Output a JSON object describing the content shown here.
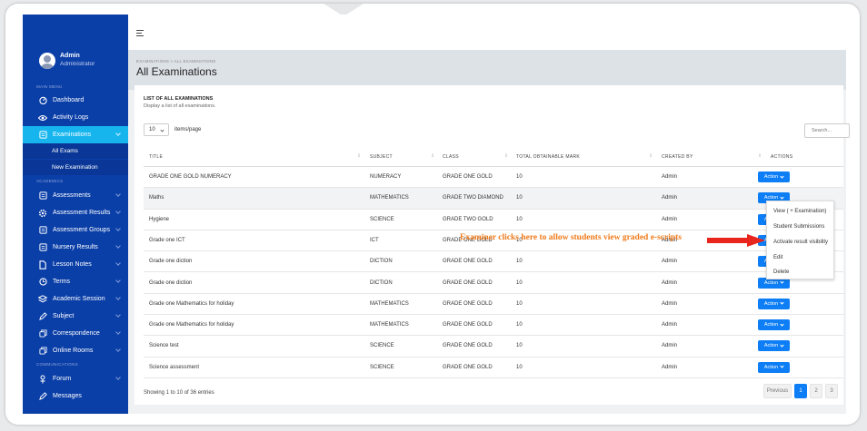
{
  "sidebar": {
    "user": {
      "name": "Admin",
      "role": "Administrator"
    },
    "sections": {
      "main": "MAIN MENU",
      "academic": "ACADEMICS",
      "communications": "COMMUNICATIONS"
    },
    "items": [
      {
        "label": "Dashboard",
        "icon": "dashboard-icon"
      },
      {
        "label": "Activity Logs",
        "icon": "eye-icon"
      },
      {
        "label": "Examinations",
        "icon": "document-icon",
        "active": true
      },
      {
        "label": "All Exams",
        "sub": true
      },
      {
        "label": "New Examination",
        "sub": true
      },
      {
        "label": "Assessments",
        "icon": "document-icon"
      },
      {
        "label": "Assessment Results",
        "icon": "gear-icon"
      },
      {
        "label": "Assessment Groups",
        "icon": "document-icon"
      },
      {
        "label": "Nursery Results",
        "icon": "document-icon"
      },
      {
        "label": "Lesson Notes",
        "icon": "file-icon"
      },
      {
        "label": "Terms",
        "icon": "clock-icon"
      },
      {
        "label": "Academic Session",
        "icon": "layers-icon"
      },
      {
        "label": "Subject",
        "icon": "pen-icon"
      },
      {
        "label": "Correspondence",
        "icon": "copy-icon"
      },
      {
        "label": "Online Rooms",
        "icon": "copy-icon"
      },
      {
        "label": "Forum",
        "icon": "forum-icon"
      },
      {
        "label": "Messages",
        "icon": "pen-icon"
      }
    ]
  },
  "header": {
    "breadcrumb": "EXAMINATIONS > ALL EXAMINATIONS",
    "title": "All Examinations"
  },
  "card": {
    "title": "LIST OF ALL EXAMINATIONS",
    "subtitle": "Display a list of all examinations.",
    "per_page_value": "10",
    "per_page_label": "items/page",
    "search_placeholder": "Search..."
  },
  "table": {
    "columns": [
      "TITLE",
      "SUBJECT",
      "CLASS",
      "TOTAL OBTAINABLE MARK",
      "CREATED BY",
      "ACTIONS"
    ],
    "rows": [
      {
        "title": "GRADE ONE GOLD NUMERACY",
        "subject": "NUMERACY",
        "class": "GRADE ONE GOLD",
        "mark": "10",
        "created_by": "Admin"
      },
      {
        "title": "Maths",
        "subject": "MATHEMATICS",
        "class": "GRADE TWO DIAMOND",
        "mark": "10",
        "created_by": "Admin"
      },
      {
        "title": "Hygiene",
        "subject": "SCIENCE",
        "class": "GRADE TWO GOLD",
        "mark": "10",
        "created_by": "Admin"
      },
      {
        "title": "Grade one ICT",
        "subject": "ICT",
        "class": "GRADE ONE GOLD",
        "mark": "10",
        "created_by": "Admin"
      },
      {
        "title": "Grade one diction",
        "subject": "DICTION",
        "class": "GRADE ONE GOLD",
        "mark": "10",
        "created_by": "Admin"
      },
      {
        "title": "Grade one diction",
        "subject": "DICTION",
        "class": "GRADE ONE GOLD",
        "mark": "10",
        "created_by": "Admin"
      },
      {
        "title": "Grade one Mathematics for holiday",
        "subject": "MATHEMATICS",
        "class": "GRADE ONE GOLD",
        "mark": "10",
        "created_by": "Admin"
      },
      {
        "title": "Grade one Mathematics for holiday",
        "subject": "MATHEMATICS",
        "class": "GRADE ONE GOLD",
        "mark": "10",
        "created_by": "Admin"
      },
      {
        "title": "Science test",
        "subject": "SCIENCE",
        "class": "GRADE ONE GOLD",
        "mark": "10",
        "created_by": "Admin"
      },
      {
        "title": "Science assessment",
        "subject": "SCIENCE",
        "class": "GRADE ONE GOLD",
        "mark": "10",
        "created_by": "Admin"
      }
    ],
    "action_label": "Action"
  },
  "dropdown": {
    "items": [
      "View ( + Examination)",
      "Student Submissions",
      "Activate result visibility",
      "Edit",
      "Delete"
    ]
  },
  "annotation": "Examiner clicks here to allow students view graded e-scripts",
  "footer": {
    "showing": "Showing 1 to 10 of 36 entries",
    "prev": "Previous",
    "pages": [
      "1",
      "2",
      "3"
    ]
  },
  "colors": {
    "sidebar": "#0b3fa8",
    "active_item": "#16b5ee",
    "button": "#0d7ef5",
    "annotation": "#f07a1a",
    "arrow": "#e8261e"
  }
}
